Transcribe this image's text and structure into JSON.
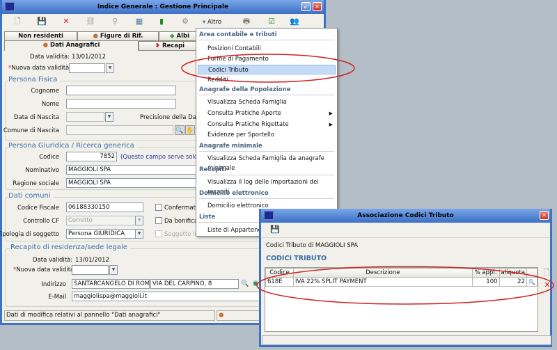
{
  "main_window": {
    "title": "Indice Generale : Gestione Principale",
    "toolbar": {
      "altro_label": "Altro"
    },
    "tabs": [
      "Non residenti",
      "Figure di Rif.",
      "Albi",
      "Dati Anagrafici",
      "Recapi"
    ],
    "data_validita_label": "Data validità:",
    "data_validita_value": "13/01/2012",
    "nuova_data_label": "Nuova data validità",
    "persona_fisica": {
      "legend": "Persona Fisica",
      "cognome": "Cognome",
      "nome": "Nome",
      "data_nascita": "Data di Nascita",
      "precisione": "Precisione della Data d",
      "comune_nascita": "Comune di Nascita"
    },
    "persona_giuridica": {
      "legend": "Persona Giuridica / Ricerca generica",
      "codice_label": "Codice",
      "codice_value": "7852",
      "codice_note": "(Questo campo serve solo per",
      "nominativo_label": "Nominativo",
      "nominativo_value": "MAGGIOLI SPA",
      "ragione_label": "Ragione sociale",
      "ragione_value": "MAGGIOLI SPA"
    },
    "dati_comuni": {
      "legend": "Dati comuni",
      "cf_label": "Codice Fiscale",
      "cf_value": "06188330150",
      "confermato": "Confermato",
      "controllo_label": "Controllo CF",
      "controllo_value": "Corretto",
      "da_bonificare": "Da bonificare",
      "tipologia_label": "Tipologia di soggetto",
      "tipologia_value": "Persona GIURIDICA",
      "soggetto_irrid": "Soggetto irrid"
    },
    "recapito": {
      "legend": "Recapito di residenza/sede legale",
      "data_validita_label": "Data validità:",
      "data_validita_value": "13/01/2012",
      "nuova_data_label": "Nuova data validità",
      "indirizzo_label": "Indirizzo",
      "comune_value": "SANTARCANGELO DI ROMAGN",
      "via_value": "VIA DEL CARPINO, 8",
      "email_label": "E-Mail",
      "email_value": "maggiolispa@maggioli.it"
    },
    "status_text": "Dati di modifica relativi al pannello \"Dati anagrafici\""
  },
  "menu": {
    "sections": [
      {
        "header": "Area contabile e tributi",
        "items": [
          "Posizioni Contabili",
          "Forme di Pagamento",
          "Codici Tributo",
          "Redditi"
        ]
      },
      {
        "header": "Anagrafe della Popolazione",
        "items": [
          "Visualizza Scheda Famiglia",
          "Consulta Pratiche Aperte",
          "Consulta Pratiche Rigettate",
          "Evidenze per Sportello"
        ]
      },
      {
        "header": "Anagrafe minimale",
        "items": [
          "Visualizza Scheda Famiglia da anagrafe minimale"
        ]
      },
      {
        "header": "Recapiti",
        "items": [
          "Visualizza il log delle importazioni dei recapiti"
        ]
      },
      {
        "header": "Domicilio elettronico",
        "items": [
          "Domicilio elettronico"
        ]
      },
      {
        "header": "Liste",
        "items": [
          "Liste di Appartenenza"
        ]
      }
    ],
    "selected": "Codici Tributo"
  },
  "dialog": {
    "title": "Associazione Codici Tributo",
    "subtitle": "Codici Tributo di MAGGIOLI SPA",
    "section": "CODICI TRIBUTO",
    "columns": [
      "Codice",
      "Descrizione",
      "% appl.",
      "aliquota"
    ],
    "rows": [
      {
        "codice": "618E",
        "descrizione": "IVA 22% SPLIT PAYMENT",
        "appl": "100",
        "aliquota": "22"
      }
    ]
  },
  "colors": {
    "annotation": "#d02020",
    "window_frame": "#3d72c4",
    "legend": "#3a6ea8"
  }
}
